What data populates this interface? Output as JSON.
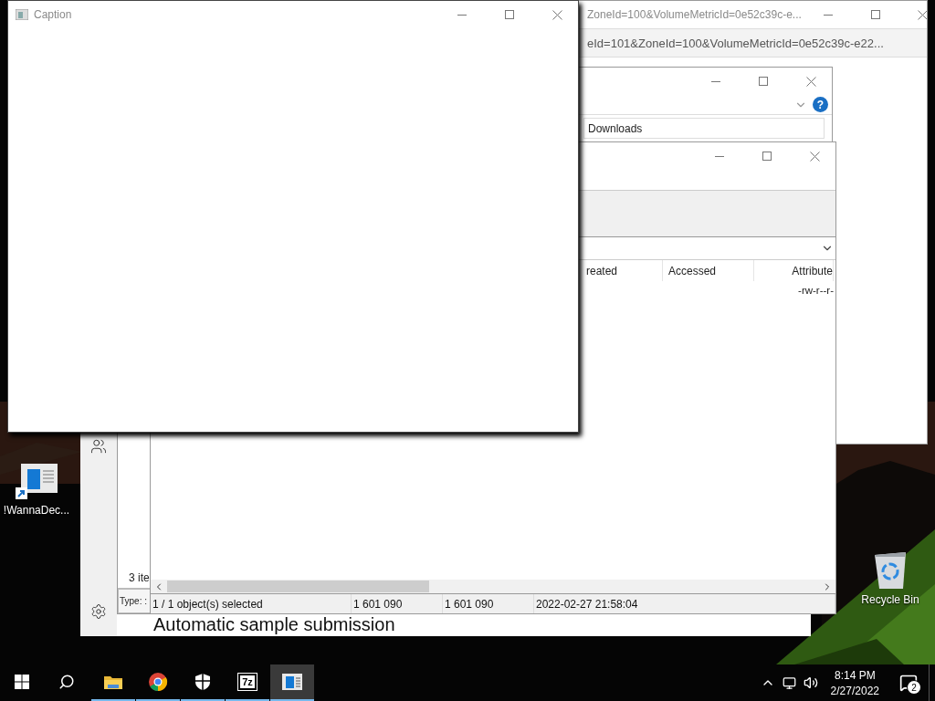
{
  "browser_window": {
    "title": "ZoneId=100&VolumeMetricId=0e52c39c-e...",
    "address": "eId=101&ZoneId=100&VolumeMetricId=0e52c39c-e22..."
  },
  "settings_window": {
    "heading": "Automatic sample submission"
  },
  "explorer_window": {
    "help": "?",
    "address": "Downloads",
    "status": "3 ite",
    "details": "Type: :"
  },
  "archive_window": {
    "columns": [
      "reated",
      "Accessed",
      "Attribute"
    ],
    "rows": [
      {
        "attribute": "-rw-r--r-"
      }
    ],
    "status": [
      "1 / 1 object(s) selected",
      "1 601 090",
      "1 601 090",
      "2022-02-27 21:58:04"
    ]
  },
  "caption_window": {
    "title": "Caption"
  },
  "desktop_icons": [
    {
      "kind": "shortcut",
      "label": "!WannaDec..."
    },
    {
      "kind": "recycle_bin",
      "label": "Recycle Bin"
    }
  ],
  "taskbar": {
    "apps": [
      {
        "kind": "folder",
        "running": true,
        "selected": false
      },
      {
        "kind": "browser",
        "running": true,
        "selected": false
      },
      {
        "kind": "shield",
        "running": true,
        "selected": false
      },
      {
        "kind": "archiver",
        "label": "7z",
        "running": true,
        "selected": false
      },
      {
        "kind": "window",
        "running": true,
        "selected": true
      }
    ],
    "time": "8:14 PM",
    "date": "2/27/2022",
    "notifications": "2"
  }
}
